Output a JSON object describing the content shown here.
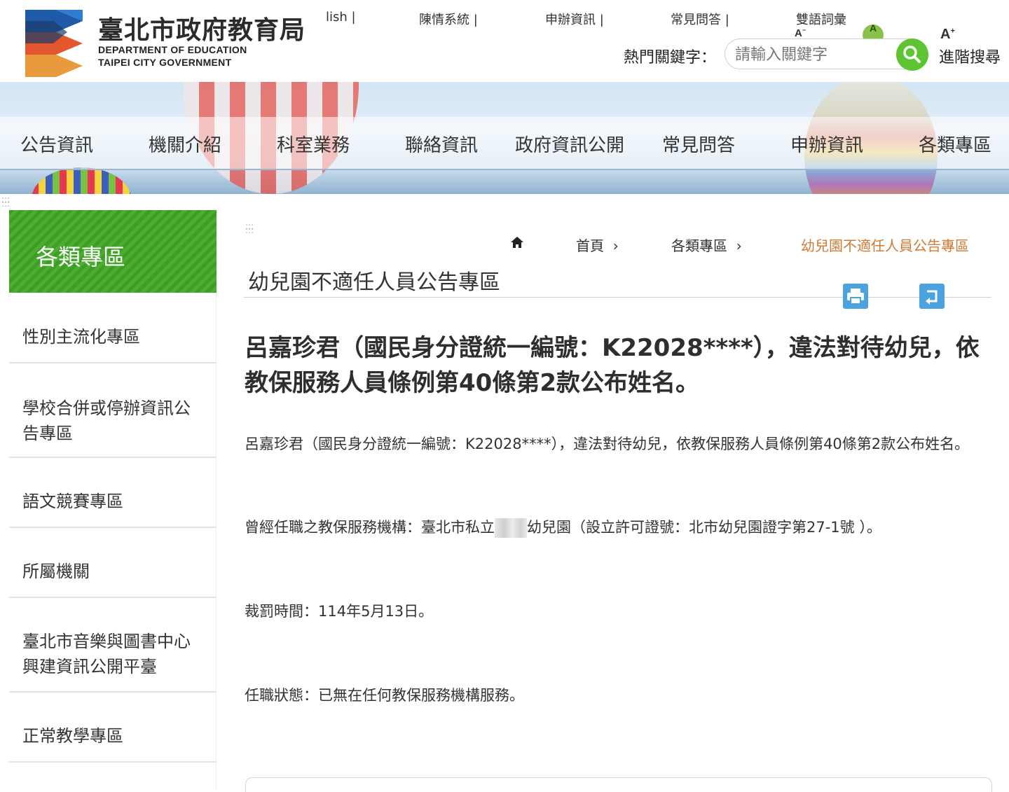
{
  "header": {
    "org_name_zh": "臺北市政府教育局",
    "org_name_en_line1": "DEPARTMENT OF  EDUCATION",
    "org_name_en_line2": "TAIPEI CITY GOVERNMENT",
    "top_links": [
      "lish |",
      "陳情系統 |",
      "申辦資訊 |",
      "常見問答 |",
      "雙語詞彙"
    ],
    "font_size_small": "A",
    "font_size_medium": "A",
    "font_size_large": "A",
    "hot_keyword_label": "熱門關鍵字：",
    "search_placeholder": "請輸入關鍵字",
    "advanced_search": "進階搜尋"
  },
  "nav": [
    "公告資訊",
    "機關介紹",
    "科室業務",
    "聯絡資訊",
    "政府資訊公開",
    "常見問答",
    "申辦資訊",
    "各類專區"
  ],
  "sidebar": {
    "title": "各類專區",
    "items": [
      {
        "label": "性別主流化專區"
      },
      {
        "label": "學校合併或停辦資訊公告專區"
      },
      {
        "label": "語文競賽專區"
      },
      {
        "label": "所屬機關"
      },
      {
        "label": "臺北市音樂與圖書中心興建資訊公開平臺"
      },
      {
        "label": "正常教學專區"
      }
    ]
  },
  "breadcrumb": {
    "home": "首頁",
    "level1": "各類專區",
    "current": "幼兒園不適任人員公告專區"
  },
  "main": {
    "page_title": "幼兒園不適任人員公告專區",
    "article_title": "呂嘉珍君（國民身分證統一編號：K22028****），違法對待幼兒，依教保服務人員條例第40條第2款公布姓名。",
    "para1": "呂嘉珍君（國民身分證統一編號：K22028****），違法對待幼兒，依教保服務人員條例第40條第2款公布姓名。",
    "para2_prefix": "曾經任職之教保服務機構：臺北市私立",
    "para2_suffix": "幼兒園（設立許可證號：北市幼兒園證字第27-1號 ）。",
    "para3": "裁罰時間：114年5月13日。",
    "para4": "任職狀態：已無在任何教保服務機構服務。"
  },
  "colors": {
    "accent_green": "#4cae31",
    "breadcrumb_current": "#d07a33",
    "tool_button_blue": "#4aa3df"
  }
}
